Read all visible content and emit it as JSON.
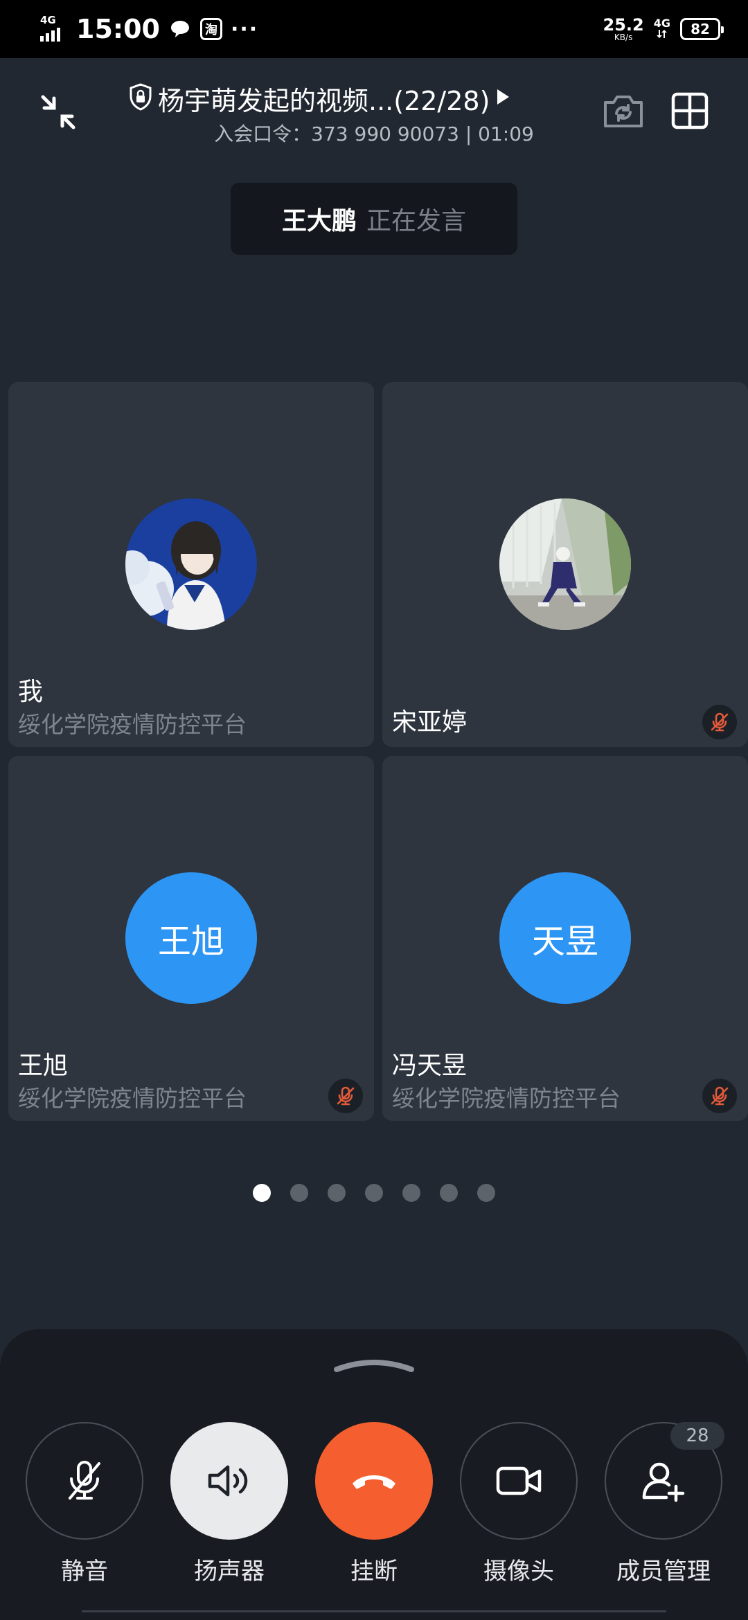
{
  "status_bar": {
    "network_left": "4G",
    "time": "15:00",
    "taobao_glyph": "淘",
    "more": "···",
    "speed_value": "25.2",
    "speed_unit": "KB/s",
    "network_right": "4G",
    "battery": "82"
  },
  "header": {
    "title": "杨宇萌发起的视频...(22/28)",
    "subtitle": "入会口令：373 990 90073 | 01:09",
    "icons": [
      "shrink-icon",
      "lock-shield-icon",
      "play-arrow-icon",
      "camera-switch-icon",
      "grid-layout-icon"
    ]
  },
  "speaking": {
    "name": "王大鹏",
    "status": "正在发言"
  },
  "participants": [
    {
      "name": "我",
      "org": "绥化学院疫情防控平台",
      "avatar": "photo-girl-illustration",
      "muted": false
    },
    {
      "name": "宋亚婷",
      "org": "",
      "avatar": "photo-street",
      "muted": true
    },
    {
      "name": "王旭",
      "org": "绥化学院疫情防控平台",
      "avatar_text": "王旭",
      "muted": true
    },
    {
      "name": "冯天昱",
      "org": "绥化学院疫情防控平台",
      "avatar_text": "天昱",
      "muted": true
    }
  ],
  "pager": {
    "pages": 7,
    "current": 1
  },
  "controls": [
    {
      "label": "静音",
      "icon": "mic-off-icon"
    },
    {
      "label": "扬声器",
      "icon": "speaker-icon"
    },
    {
      "label": "挂断",
      "icon": "hangup-icon"
    },
    {
      "label": "摄像头",
      "icon": "video-camera-icon"
    },
    {
      "label": "成员管理",
      "icon": "add-member-icon"
    }
  ],
  "member_count": "28",
  "colors": {
    "background": "#222831",
    "tile": "#2e353e",
    "avatar_blue": "#2d95f4",
    "hangup_red": "#f55f2f",
    "mute_red": "#e25a3a"
  }
}
